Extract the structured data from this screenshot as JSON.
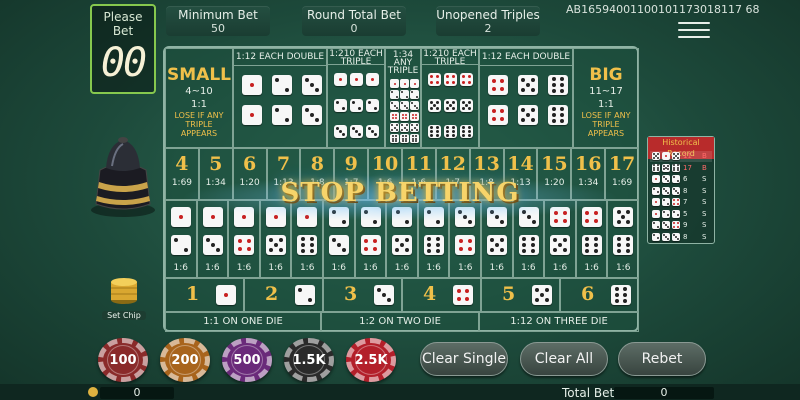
{
  "top_bar": {
    "please_bet_label": "Please Bet",
    "countdown": "00",
    "minimum_bet_label": "Minimum Bet",
    "minimum_bet_value": "50",
    "round_total_bet_label": "Round Total Bet",
    "round_total_bet_value": "0",
    "unopened_triples_label": "Unopened Triples",
    "unopened_triples_value": "2",
    "game_id": "AB16594001100101173018117 68"
  },
  "board": {
    "small_label": "SMALL",
    "small_range": "4~10",
    "small_odds": "1:1",
    "small_note": "LOSE IF ANY TRIPLE APPEARS",
    "big_label": "BIG",
    "big_range": "11~17",
    "big_odds": "1:1",
    "big_note": "LOSE IF ANY TRIPLE APPEARS",
    "double_head_left": "1:12  EACH DOUBLE",
    "double_head_right": "1:12  EACH DOUBLE",
    "triple_head_left": "1:210 EACH TRIPLE",
    "triple_head_right": "1:210 EACH TRIPLE",
    "any_triple_head": "1:34 ANY TRIPLE",
    "totals": [
      {
        "n": "4",
        "o": "1:69"
      },
      {
        "n": "5",
        "o": "1:34"
      },
      {
        "n": "6",
        "o": "1:20"
      },
      {
        "n": "7",
        "o": "1:13"
      },
      {
        "n": "8",
        "o": "1:8"
      },
      {
        "n": "9",
        "o": "1:7"
      },
      {
        "n": "10",
        "o": "1:6"
      },
      {
        "n": "11",
        "o": "1:6"
      },
      {
        "n": "12",
        "o": "1:7"
      },
      {
        "n": "13",
        "o": "1:8"
      },
      {
        "n": "14",
        "o": "1:13"
      },
      {
        "n": "15",
        "o": "1:20"
      },
      {
        "n": "16",
        "o": "1:34"
      },
      {
        "n": "17",
        "o": "1:69"
      }
    ],
    "combo_odds": "1:6",
    "singles": [
      "1",
      "2",
      "3",
      "4",
      "5",
      "6"
    ],
    "one_die": "1:1   ON ONE DIE",
    "two_die": "1:2   ON TWO DIE",
    "three_die": "1:12   ON THREE DIE"
  },
  "overlay": {
    "stop_text": "STOP BETTING"
  },
  "history": {
    "title": "Historical Record",
    "rows": [
      {
        "total": "11",
        "result": "B"
      },
      {
        "total": "17",
        "result": "B"
      },
      {
        "total": "6",
        "result": "S"
      },
      {
        "total": "8",
        "result": "S"
      },
      {
        "total": "7",
        "result": "S"
      },
      {
        "total": "5",
        "result": "S"
      },
      {
        "total": "9",
        "result": "S"
      },
      {
        "total": "8",
        "result": "S"
      }
    ]
  },
  "chips": [
    {
      "label": "100",
      "color": "#8a2a2a"
    },
    {
      "label": "200",
      "color": "#a8641c"
    },
    {
      "label": "500",
      "color": "#6a2a7a"
    },
    {
      "label": "1.5K",
      "color": "#2a2a2a"
    },
    {
      "label": "2.5K",
      "color": "#b31f2a"
    }
  ],
  "set_chip_label": "Set Chip",
  "actions": {
    "clear_single": "Clear Single",
    "clear_all": "Clear All",
    "rebet": "Rebet"
  },
  "footer": {
    "balance": "0",
    "total_bet_label": "Total Bet",
    "total_bet_value": "0"
  },
  "colors": {
    "accent_gold": "#f0c04a",
    "felt": "#2f6e58",
    "stop_glow": "#3fa0ff"
  },
  "icons": [
    "menu-icon",
    "dice-shaker-icon",
    "coin-stack-icon",
    "coin-icon"
  ]
}
